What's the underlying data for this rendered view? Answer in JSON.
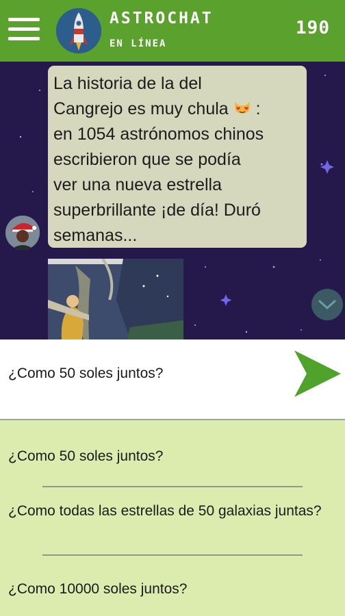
{
  "header": {
    "title": "ASTROCHAT",
    "status": "EN LÍNEA",
    "score": "190",
    "menu_icon": "hamburger-menu-icon",
    "logo_icon": "rocket-icon",
    "color": "#5aa12d"
  },
  "chat": {
    "message_lines": [
      "La historia de la del",
      "Cangrejo es muy chula",
      ": ",
      "en 1054 astrónomos chinos",
      "escribieron que se podía",
      "ver una nueva estrella",
      "superbrillante ¡de día! Duró",
      "semanas..."
    ],
    "emoji": "heart-eyes-cat-emoji",
    "scroll_icon": "chevron-down-icon"
  },
  "input": {
    "value": "¿Como 50 soles juntos?",
    "send_icon": "send-arrow-icon"
  },
  "options": [
    "¿Como 50 soles juntos?",
    "¿Como todas las estrellas de 50 galaxias juntas?",
    "¿Como 10000 soles juntos?"
  ]
}
